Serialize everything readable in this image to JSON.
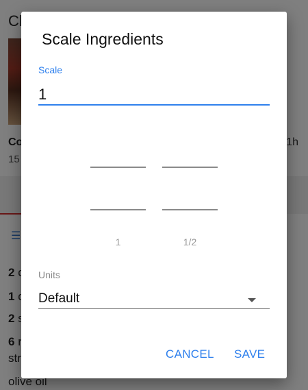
{
  "background": {
    "title": "Cl",
    "meta_title": "Co",
    "meta_right": "1h",
    "meta_sub": "15",
    "lines": [
      {
        "bold": "2",
        "rest": " c"
      },
      {
        "bold": "1",
        "rest": " c"
      },
      {
        "bold": "2",
        "rest": " s"
      },
      {
        "bold": "6",
        "rest": " r"
      },
      {
        "bold": "",
        "rest": "str"
      },
      {
        "bold": "",
        "rest": "olive oil"
      }
    ]
  },
  "dialog": {
    "title": "Scale Ingredients",
    "scale_label": "Scale",
    "scale_value": "1",
    "picker": {
      "whole": "1",
      "fraction": "1/2"
    },
    "units_label": "Units",
    "units_value": "Default",
    "cancel_label": "CANCEL",
    "save_label": "SAVE"
  },
  "colors": {
    "accent": "#2f80ed",
    "scrim": "rgba(0,0,0,0.5)"
  }
}
